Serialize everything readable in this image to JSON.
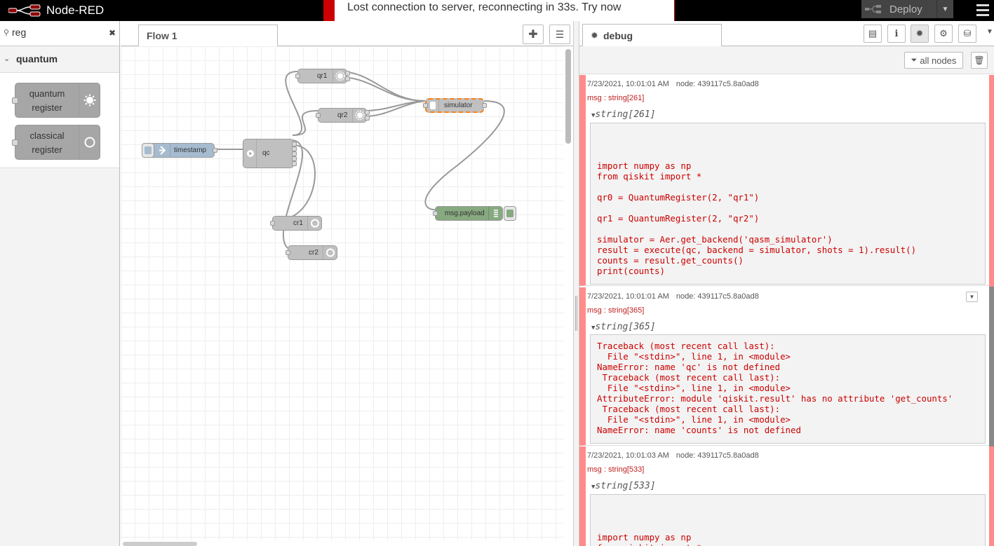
{
  "header": {
    "app_title": "Node-RED",
    "deploy_label": "Deploy",
    "notification": "Lost connection to server, reconnecting in 33s. Try now"
  },
  "palette": {
    "search_value": "reg",
    "category": "quantum",
    "nodes": [
      {
        "label_line1": "quantum",
        "label_line2": "register",
        "icon": "sun-icon"
      },
      {
        "label_line1": "classical",
        "label_line2": "register",
        "icon": "circle-icon"
      }
    ]
  },
  "workspace": {
    "tab_label": "Flow 1",
    "nodes": {
      "timestamp": "timestamp",
      "qc": "qc",
      "qr1": "qr1",
      "qr2": "qr2",
      "simulator": "simulator",
      "cr1": "cr1",
      "cr2": "cr2",
      "payload": "msg.payload"
    }
  },
  "sidebar": {
    "tab_label": "debug",
    "filter_label": "all nodes",
    "messages": [
      {
        "timestamp": "7/23/2021, 10:01:01 AM",
        "node": "node: 439117c5.8a0ad8",
        "type": "msg : string[261]",
        "tree": "string[261]",
        "body": "\n\n\nimport numpy as np\nfrom qiskit import *\n\nqr0 = QuantumRegister(2, \"qr1\")\n\nqr1 = QuantumRegister(2, \"qr2\")\n\nsimulator = Aer.get_backend('qasm_simulator')\nresult = execute(qc, backend = simulator, shots = 1).result()\ncounts = result.get_counts()\nprint(counts)"
      },
      {
        "timestamp": "7/23/2021, 10:01:01 AM",
        "node": "node: 439117c5.8a0ad8",
        "type": "msg : string[365]",
        "tree": "string[365]",
        "body": "Traceback (most recent call last):\n  File \"<stdin>\", line 1, in <module>\nNameError: name 'qc' is not defined\n Traceback (most recent call last):\n  File \"<stdin>\", line 1, in <module>\nAttributeError: module 'qiskit.result' has no attribute 'get_counts'\n Traceback (most recent call last):\n  File \"<stdin>\", line 1, in <module>\nNameError: name 'counts' is not defined"
      },
      {
        "timestamp": "7/23/2021, 10:01:03 AM",
        "node": "node: 439117c5.8a0ad8",
        "type": "msg : string[533]",
        "tree": "string[533]",
        "body": "\n\n\nimport numpy as np\nfrom qiskit import *"
      }
    ]
  },
  "colors": {
    "header_bg": "#000000",
    "notification_accent": "#cc0000",
    "debug_error": "#ff8b8b",
    "inject_node": "#a6bbcf",
    "debug_node": "#87a980",
    "quantum_node": "#a6a6a6",
    "selected_outline": "#ff7f0e"
  }
}
